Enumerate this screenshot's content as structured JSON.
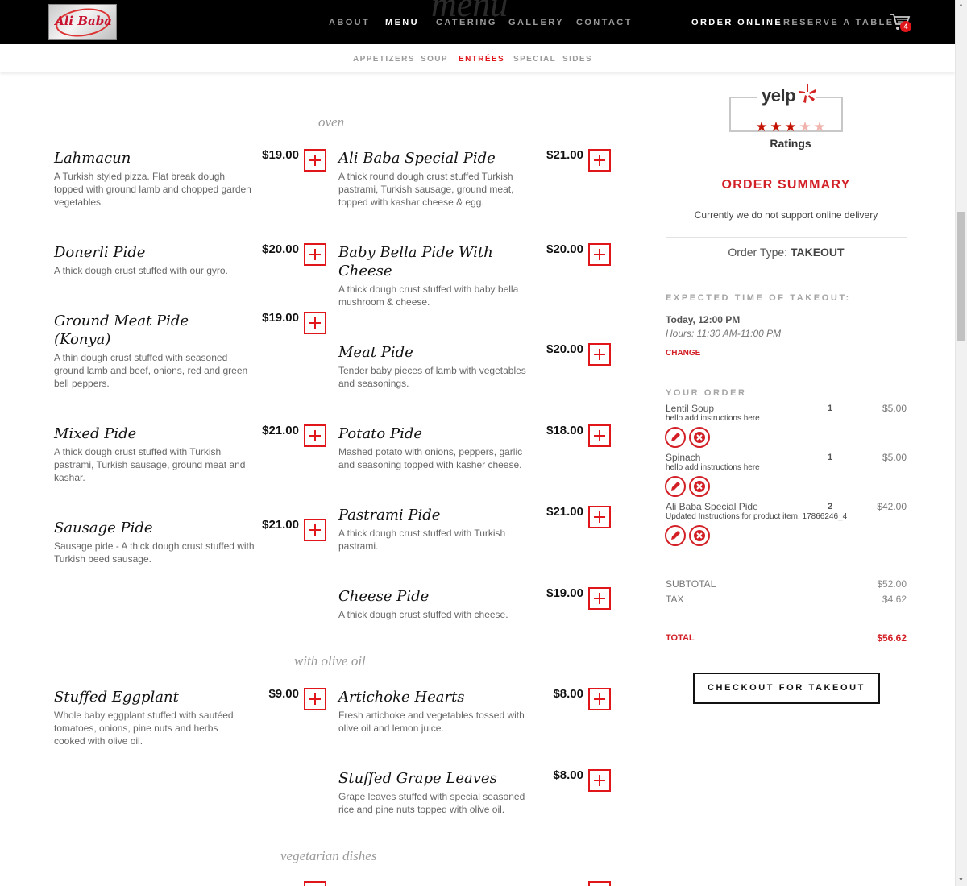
{
  "brand": {
    "logo_text": "Ali Baba",
    "ghost_title": "menu"
  },
  "nav": {
    "links": [
      "ABOUT",
      "MENU",
      "CATERING",
      "GALLERY",
      "CONTACT"
    ],
    "order_online": "ORDER ONLINE",
    "reserve": "RESERVE A TABLE",
    "cart_count": "4"
  },
  "subnav": {
    "links": [
      "APPETIZERS",
      "SOUP",
      "ENTRÉES",
      "SPECIAL",
      "SIDES"
    ],
    "active": "ENTRÉES"
  },
  "menu": {
    "sections": [
      "oven",
      "with olive oil",
      "vegetarian dishes"
    ],
    "oven_left": [
      {
        "name": "Lahmacun",
        "price": "$19.00",
        "desc": "A Turkish styled pizza. Flat break dough topped with ground lamb and chopped garden vegetables."
      },
      {
        "name": "Donerli Pide",
        "price": "$20.00",
        "desc": "A thick dough crust stuffed with our gyro."
      },
      {
        "name": "Ground Meat Pide (Konya)",
        "price": "$19.00",
        "desc": "A thin dough crust stuffed with seasoned ground lamb and beef, onions, red and green bell peppers."
      },
      {
        "name": "Mixed Pide",
        "price": "$21.00",
        "desc": "A thick dough crust stuffed with Turkish pastrami, Turkish sausage, ground meat and kashar."
      },
      {
        "name": "Sausage Pide",
        "price": "$21.00",
        "desc": "Sausage pide - A thick dough crust stuffed with Turkish beed sausage."
      }
    ],
    "oven_right": [
      {
        "name": "Ali Baba Special Pide",
        "price": "$21.00",
        "desc": "A thick round dough crust stuffed Turkish pastrami, Turkish sausage, ground meat, topped with kashar cheese & egg."
      },
      {
        "name": "Baby Bella Pide With Cheese",
        "price": "$20.00",
        "desc": "A thick dough crust stuffed with baby bella mushroom & cheese."
      },
      {
        "name": "Meat Pide",
        "price": "$20.00",
        "desc": "Tender baby pieces of lamb with vegetables and seasonings."
      },
      {
        "name": "Potato Pide",
        "price": "$18.00",
        "desc": "Mashed potato with onions, peppers, garlic and seasoning topped with kasher cheese."
      },
      {
        "name": "Pastrami Pide",
        "price": "$21.00",
        "desc": "A thick dough crust stuffed with Turkish pastrami."
      },
      {
        "name": "Cheese Pide",
        "price": "$19.00",
        "desc": "A thick dough crust stuffed with cheese."
      }
    ],
    "olive_left": [
      {
        "name": "Stuffed Eggplant",
        "price": "$9.00",
        "desc": "Whole baby eggplant stuffed with sautéed tomatoes, onions, pine nuts and herbs cooked with olive oil."
      }
    ],
    "olive_right": [
      {
        "name": "Artichoke Hearts",
        "price": "$8.00",
        "desc": "Fresh artichoke and vegetables tossed with olive oil and lemon juice."
      },
      {
        "name": "Stuffed Grape Leaves",
        "price": "$8.00",
        "desc": "Grape leaves stuffed with special seasoned rice and pine nuts topped with olive oil."
      }
    ]
  },
  "yelp": {
    "word": "yelp",
    "rating": 3,
    "max": 5,
    "label": "Ratings"
  },
  "summary": {
    "title": "ORDER SUMMARY",
    "note": "Currently we do not support online delivery",
    "order_type_label": "Order Type:",
    "order_type": "TAKEOUT",
    "expected_label": "EXPECTED TIME OF TAKEOUT:",
    "time": "Today, 12:00 PM",
    "hours": "Hours: 11:30 AM-11:00 PM",
    "change": "CHANGE",
    "your_order_label": "YOUR ORDER",
    "items": [
      {
        "name": "Lentil Soup",
        "instructions": "hello add instructions here",
        "qty": "1",
        "price": "$5.00"
      },
      {
        "name": "Spinach",
        "instructions": "hello add instructions here",
        "qty": "1",
        "price": "$5.00"
      },
      {
        "name": "Ali Baba Special Pide",
        "instructions": "Updated Instructions for product item: 17866246_4",
        "qty": "2",
        "price": "$42.00"
      }
    ],
    "subtotal_label": "SUBTOTAL",
    "subtotal": "$52.00",
    "tax_label": "TAX",
    "tax": "$4.62",
    "total_label": "TOTAL",
    "total": "$56.62",
    "checkout": "CHECKOUT FOR TAKEOUT"
  },
  "colors": {
    "accent": "#e0161b",
    "navbar": "#000000",
    "yelp_star": "#c41200"
  }
}
